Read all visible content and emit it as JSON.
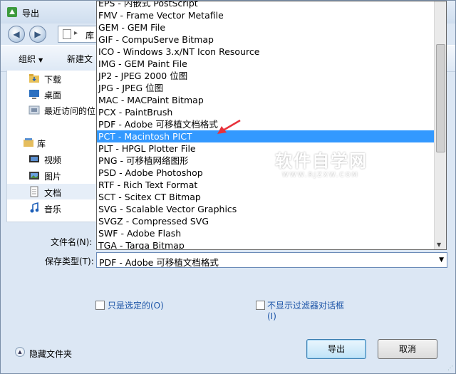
{
  "window": {
    "title": "导出"
  },
  "nav": {
    "address_label": "库"
  },
  "toolbar": {
    "organize": "组织",
    "new_folder": "新建文"
  },
  "sidebar": {
    "items": [
      {
        "label": "下载",
        "icon": "download-folder-icon"
      },
      {
        "label": "桌面",
        "icon": "desktop-icon"
      },
      {
        "label": "最近访问的位",
        "icon": "recent-places-icon"
      },
      {
        "label": "库",
        "icon": "library-icon"
      },
      {
        "label": "视频",
        "icon": "videos-icon"
      },
      {
        "label": "图片",
        "icon": "pictures-icon"
      },
      {
        "label": "文档",
        "icon": "documents-icon"
      },
      {
        "label": "音乐",
        "icon": "music-icon"
      }
    ]
  },
  "dropdown": {
    "options": [
      "EPS - 内嵌式 PostScript",
      "FMV - Frame Vector Metafile",
      "GEM - GEM File",
      "GIF - CompuServe Bitmap",
      "ICO - Windows 3.x/NT Icon Resource",
      "IMG - GEM Paint File",
      "JP2 - JPEG 2000 位图",
      "JPG - JPEG 位图",
      "MAC - MACPaint Bitmap",
      "PCX - PaintBrush",
      "PDF - Adobe 可移植文档格式",
      "PCT - Macintosh PICT",
      "PLT - HPGL Plotter File",
      "PNG - 可移植网络图形",
      "PSD - Adobe Photoshop",
      "RTF - Rich Text Format",
      "SCT - Scitex CT Bitmap",
      "SVG - Scalable Vector Graphics",
      "SVGZ - Compressed SVG",
      "SWF - Adobe Flash",
      "TGA - Targa Bitmap"
    ],
    "selected": "PCT - Macintosh PICT"
  },
  "watermark": {
    "main": "软件自学网",
    "sub": "WWW.RJZXW.COM"
  },
  "form": {
    "filename_label": "文件名(N):",
    "filetype_label": "保存类型(T):",
    "filetype_value": "PDF - Adobe 可移植文档格式",
    "only_selected": "只是选定的(O)",
    "no_filter_dialog": "不显示过滤器对话框",
    "no_filter_dialog_key": "(I)"
  },
  "footer": {
    "hide_folders": "隐藏文件夹",
    "export": "导出",
    "cancel": "取消"
  },
  "colors": {
    "selection": "#3399ff",
    "arrow": "#e8313a",
    "link_text": "#1e56a8"
  }
}
